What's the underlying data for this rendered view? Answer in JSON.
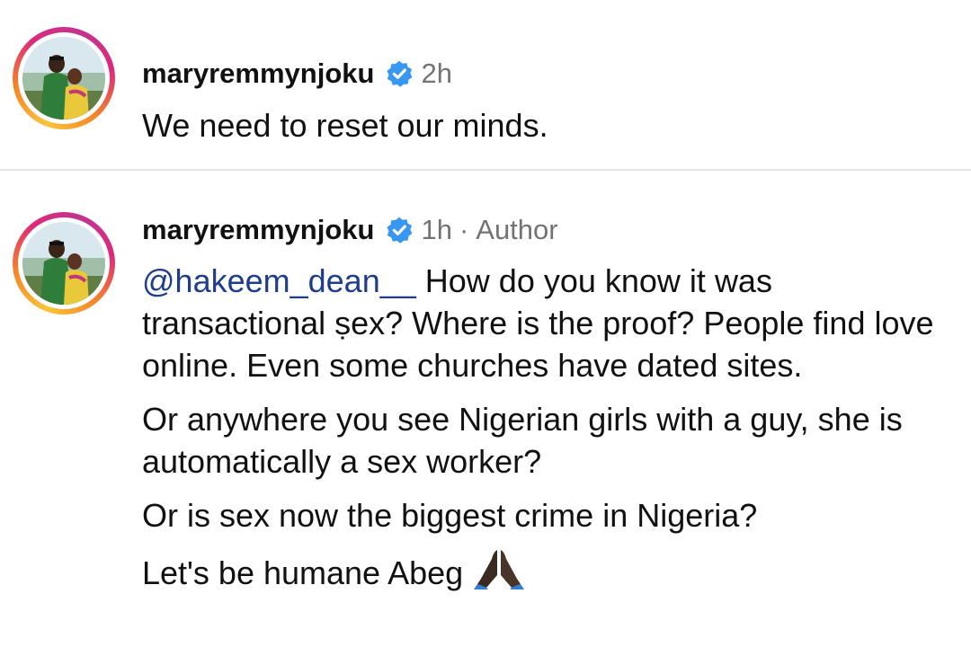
{
  "comments": [
    {
      "username": "maryremmynjoku",
      "time": "2h",
      "meta_separator": "",
      "meta_extra": "",
      "paragraphs": [
        "We need to reset our minds."
      ]
    },
    {
      "username": "maryremmynjoku",
      "time": "1h",
      "meta_separator": "·",
      "meta_extra": "Author",
      "mention": "@hakeem_dean__",
      "paragraphs": [
        " How do you know it was transactional ṣex? Where is the proof? People find love online. Even some churches have dated sites.",
        "Or anywhere you see Nigerian girls with a guy, she is automatically a sex worker?",
        "Or is sex now the biggest crime in Nigeria?",
        "Let's be humane Abeg"
      ]
    }
  ],
  "colors": {
    "verified_badge": "#3897f0",
    "mention": "#1e3d8a",
    "meta": "#737373",
    "story_ring": [
      "#f9c43a",
      "#f58529",
      "#dd2a7b"
    ]
  },
  "icons": {
    "verified": "verified-badge-icon",
    "emoji": "folded-hands-emoji"
  }
}
